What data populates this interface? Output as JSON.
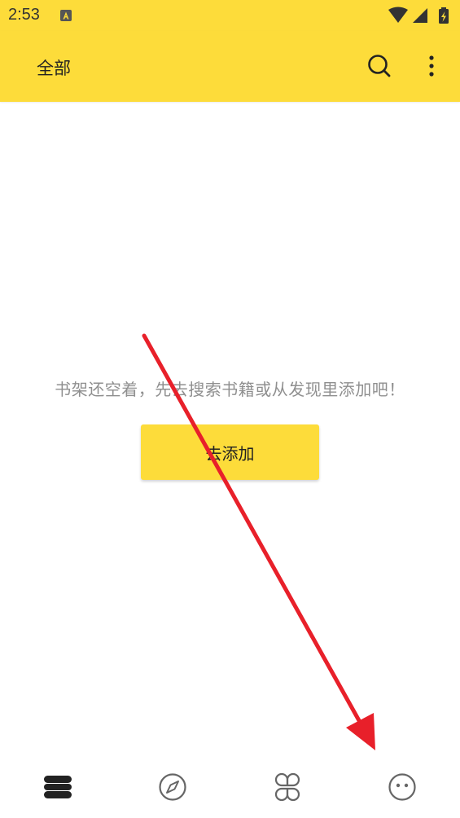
{
  "status_bar": {
    "time": "2:53",
    "notification_icon": "a-letter-notification-icon",
    "icons": [
      "wifi-icon",
      "signal-icon",
      "battery-charging-icon"
    ]
  },
  "app_bar": {
    "title": "全部",
    "actions": [
      "search-icon",
      "more-vert-icon"
    ]
  },
  "empty_state": {
    "message": "书架还空着，先去搜索书籍或从发现里添加吧！",
    "button_label": "去添加"
  },
  "bottom_nav": {
    "items": [
      {
        "icon": "bookshelf-icon",
        "active": true
      },
      {
        "icon": "compass-icon",
        "active": false
      },
      {
        "icon": "grid-rss-icon",
        "active": false
      },
      {
        "icon": "face-profile-icon",
        "active": false
      }
    ]
  },
  "colors": {
    "accent": "#fddc3a",
    "annotation_arrow": "#e8202a",
    "hint_text": "#8f8f8f",
    "icon_inactive": "#666666",
    "icon_active": "#222222"
  }
}
